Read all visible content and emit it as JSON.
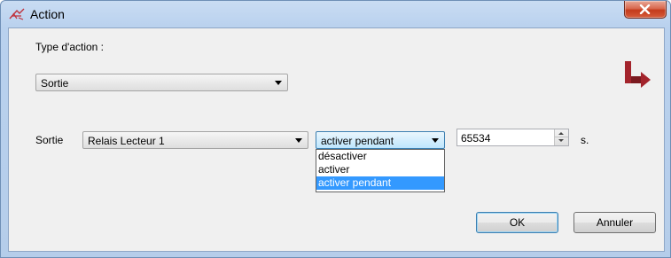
{
  "window": {
    "title": "Action",
    "close_symbol": "X",
    "icon": "action-wand-icon"
  },
  "form": {
    "type_label": "Type d'action :",
    "type_value": "Sortie",
    "output_label": "Sortie",
    "output_value": "Relais Lecteur 1",
    "mode_value": "activer pendant",
    "mode_options": [
      "désactiver",
      "activer",
      "activer pendant"
    ],
    "mode_selected_index": 2,
    "duration_value": "65534",
    "duration_unit": "s."
  },
  "buttons": {
    "ok": "OK",
    "cancel": "Annuler"
  },
  "colors": {
    "selection": "#3399ff",
    "logo": "#a3242c"
  }
}
